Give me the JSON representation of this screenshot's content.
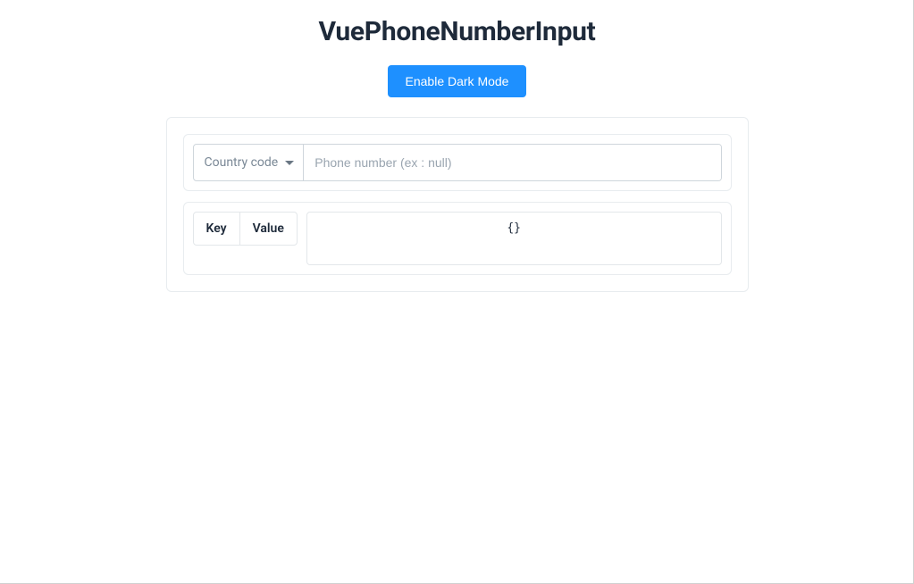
{
  "header": {
    "title": "VuePhoneNumberInput",
    "dark_mode_button": "Enable Dark Mode"
  },
  "phone_input": {
    "country_label": "Country code",
    "phone_placeholder": "Phone number (ex : null)",
    "phone_value": ""
  },
  "results": {
    "key_header": "Key",
    "value_header": "Value",
    "payload_text": "{}"
  }
}
